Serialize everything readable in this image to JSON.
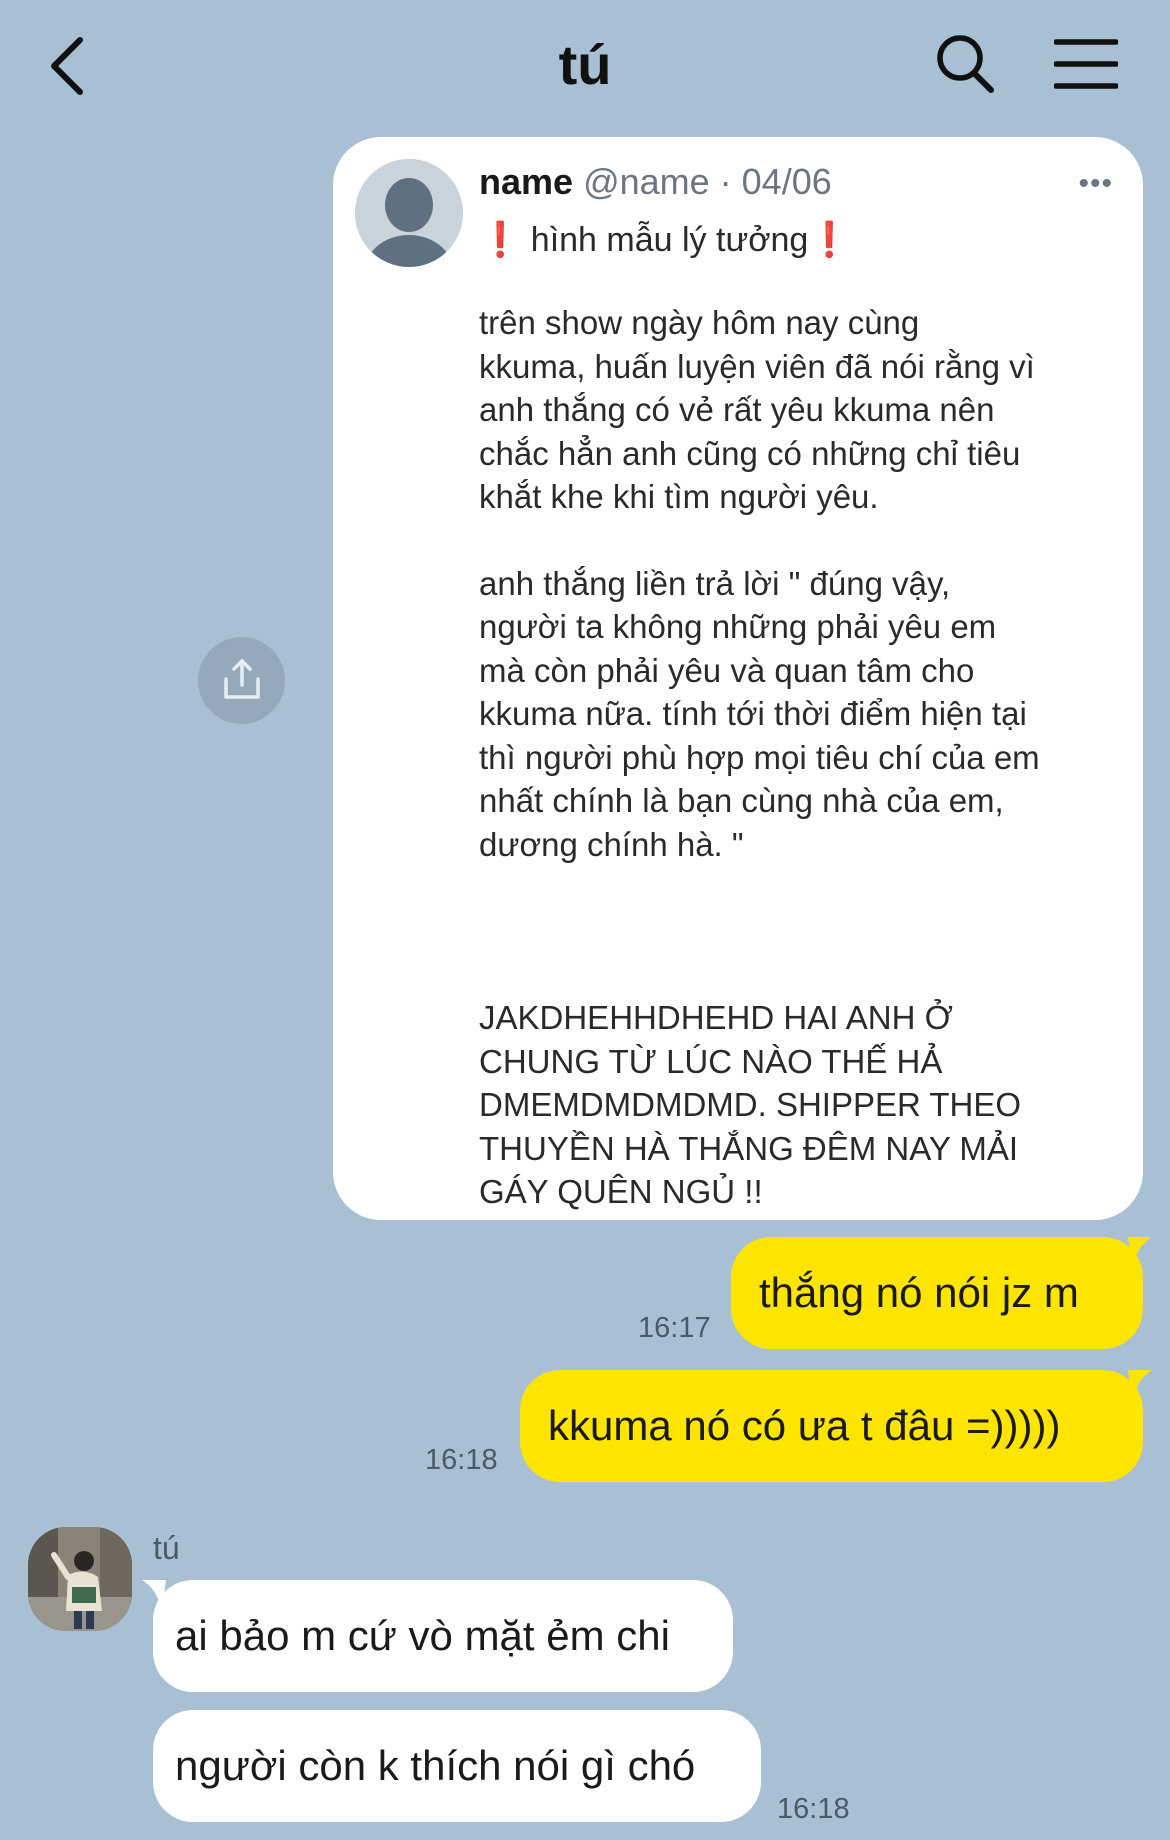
{
  "header": {
    "title": "tú",
    "back_icon": "chevron-left-icon",
    "search_icon": "search-icon",
    "menu_icon": "hamburger-menu-icon"
  },
  "shared_post": {
    "name": "name",
    "handle_date": "@name · 04/06",
    "more": "•••",
    "headline_left": "❗",
    "headline_text": " hình mẫu lý tưởng",
    "headline_right": "❗",
    "paragraphs": [
      "trên show ngày hôm nay cùng\nkkuma, huấn luyện viên đã nói rằng vì\nanh thắng có vẻ rất yêu kkuma nên\nchắc hẳn anh cũng có những chỉ tiêu\nkhắt khe khi tìm người yêu.",
      "anh thắng liền trả lời \" đúng vậy,\nngười ta không những phải yêu em\nmà còn phải yêu và quan tâm cho\nkkuma nữa. tính tới thời điểm hiện tại\nthì người phù hợp mọi tiêu chí của em\nnhất chính là bạn cùng nhà của em,\ndương chính hà. \"",
      "JAKDHEHHDHEHD HAI ANH Ở\nCHUNG TỪ LÚC NÀO THẾ HẢ\nDMEMDMDMDMD. SHIPPER THEO\nTHUYỀN HÀ THẮNG ĐÊM NAY MẢI\nGÁY QUÊN NGỦ !!"
    ]
  },
  "messages": {
    "out1": {
      "text": "thắng nó nói jz m",
      "time": "16:17"
    },
    "out2": {
      "text": "kkuma nó có ưa t đâu =)))))",
      "time": "16:18"
    },
    "sender": "tú",
    "in1": {
      "text": "ai bảo m cứ vò mặt ẻm chi"
    },
    "in2": {
      "text": "người còn k thích nói gì chó",
      "time": "16:18"
    }
  }
}
